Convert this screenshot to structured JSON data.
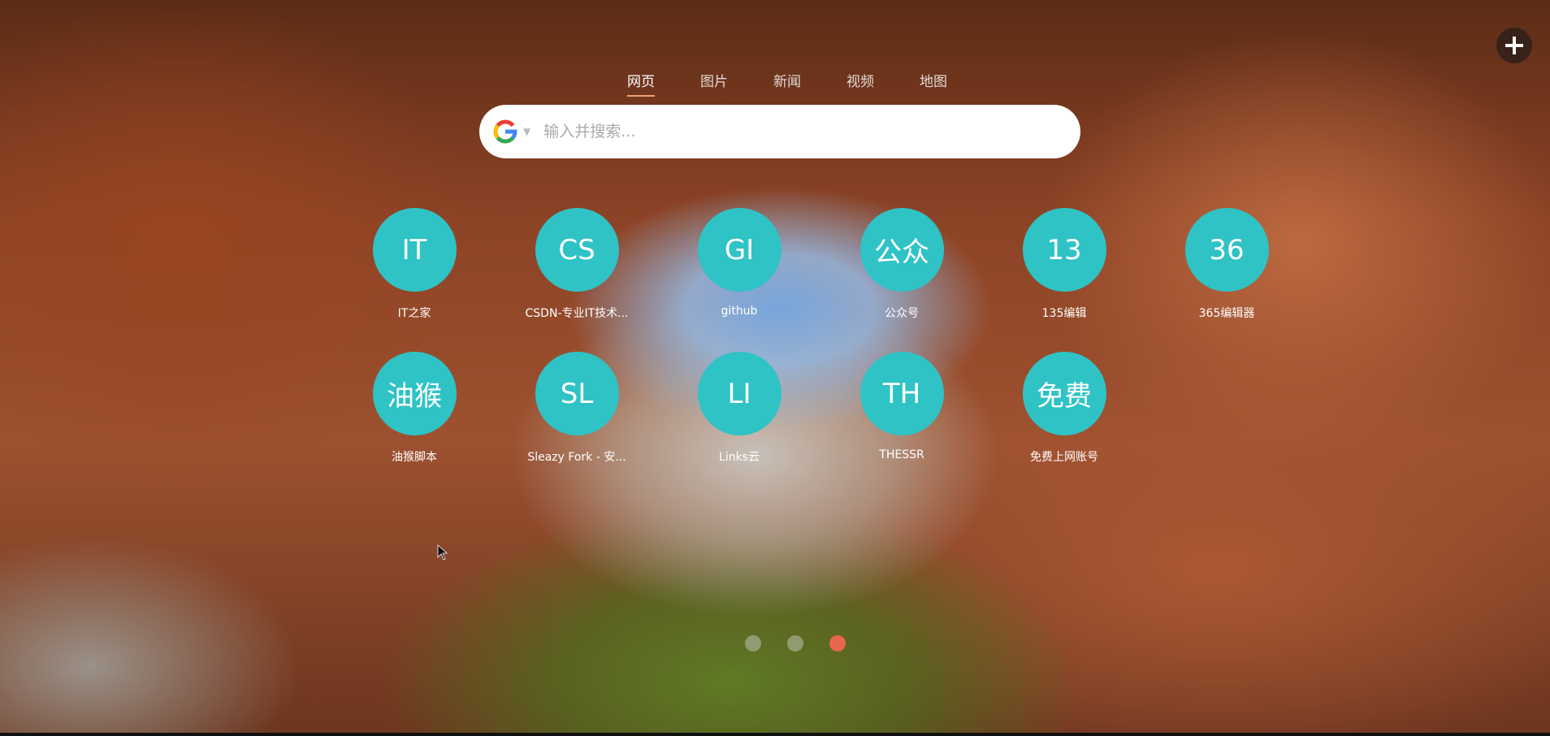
{
  "colors": {
    "tile_bg": "#2fc3c6",
    "active_tab_underline": "#f0a070",
    "active_dot": "#e8664c"
  },
  "tabs": [
    {
      "label": "网页",
      "active": true
    },
    {
      "label": "图片",
      "active": false
    },
    {
      "label": "新闻",
      "active": false
    },
    {
      "label": "视频",
      "active": false
    },
    {
      "label": "地图",
      "active": false
    }
  ],
  "search": {
    "engine_icon": "google-icon",
    "placeholder": "输入并搜索...",
    "value": ""
  },
  "add_button_icon": "plus-icon",
  "shortcuts": [
    {
      "abbr": "IT",
      "label": "IT之家"
    },
    {
      "abbr": "CS",
      "label": "CSDN-专业IT技术..."
    },
    {
      "abbr": "GI",
      "label": "github"
    },
    {
      "abbr": "公众",
      "label": "公众号"
    },
    {
      "abbr": "13",
      "label": "135编辑"
    },
    {
      "abbr": "36",
      "label": "365编辑器"
    },
    {
      "abbr": "油猴",
      "label": "油猴脚本"
    },
    {
      "abbr": "SL",
      "label": "Sleazy Fork - 安..."
    },
    {
      "abbr": "LI",
      "label": "Links云"
    },
    {
      "abbr": "TH",
      "label": "THESSR"
    },
    {
      "abbr": "免费",
      "label": "免费上网账号"
    }
  ],
  "pagination": {
    "pages": 3,
    "active_index": 2
  }
}
